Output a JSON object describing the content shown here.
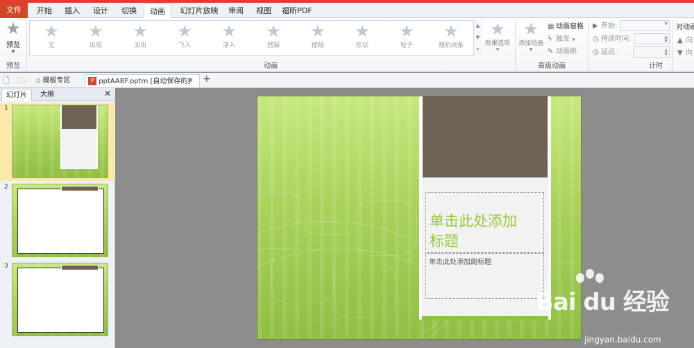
{
  "ribbon_tabs": [
    "文件",
    "开始",
    "插入",
    "设计",
    "切换",
    "动画",
    "幻灯片放映",
    "审阅",
    "视图",
    "福昕PDF"
  ],
  "active_tab": "动画",
  "preview": {
    "label": "预览",
    "group": "预览"
  },
  "gallery": {
    "items": [
      "无",
      "出现",
      "淡出",
      "飞入",
      "浮入",
      "劈裂",
      "擦除",
      "形状",
      "轮子",
      "随机线条"
    ],
    "group": "动画"
  },
  "effect_options": "效果选项",
  "advanced": {
    "add_animation": "添加动画",
    "pane": "动画窗格",
    "trigger": "触发",
    "painter": "动画刷",
    "group": "高级动画"
  },
  "timing": {
    "start": "开始:",
    "duration": "持续时间:",
    "delay": "延迟:",
    "group": "计时"
  },
  "reorder": {
    "title": "对动画",
    "up": "向",
    "down": "向"
  },
  "doc_tabs": {
    "template": "模板专区",
    "document": "pptAABF.pptm [自动保存的]",
    "close": "✕",
    "add": "+"
  },
  "left_pane": {
    "tab_slides": "幻灯片",
    "tab_outline": "大纲",
    "close": "✕",
    "thumbs": [
      "1",
      "2",
      "3"
    ]
  },
  "slide": {
    "title_placeholder_line1": "单击此处添加",
    "title_placeholder_line2": "标题",
    "subtitle_placeholder": "单击此处添加副标题"
  },
  "watermark": {
    "logo": "Bai du 经验",
    "url": "jingyan.baidu.com"
  },
  "colors": {
    "file_tab": "#d24726",
    "slide_green": "#a9d25a",
    "photo": "#6f6254",
    "title_text": "#97c93a"
  }
}
